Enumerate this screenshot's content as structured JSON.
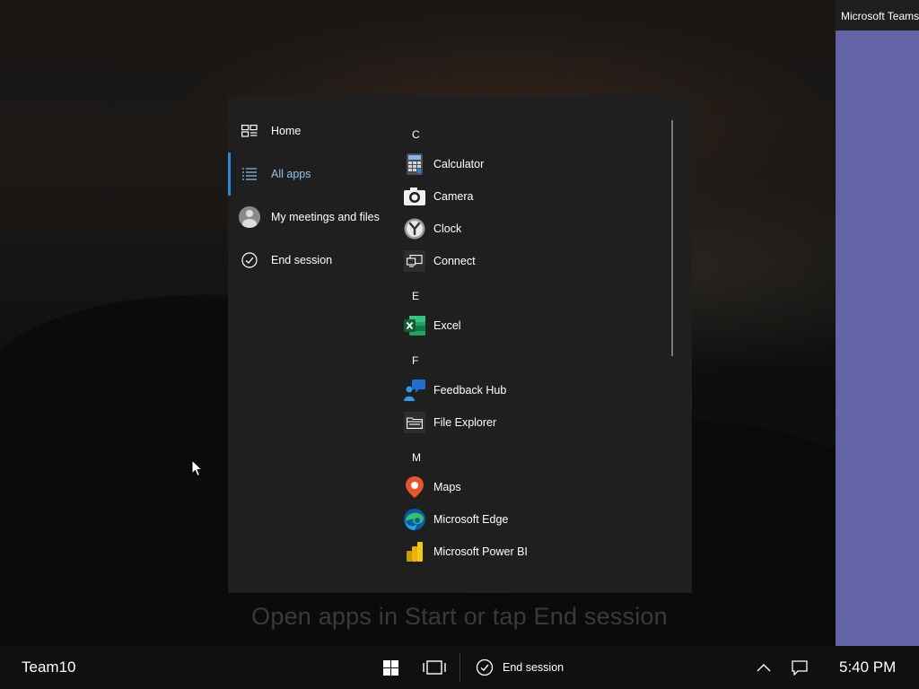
{
  "session": {
    "name": "Team10"
  },
  "hint": "Open apps in Start or tap End session",
  "teams_window": {
    "title": "Microsoft Teams"
  },
  "start_menu": {
    "nav": [
      {
        "label": "Home",
        "icon": "home-icon"
      },
      {
        "label": "All apps",
        "icon": "all-apps-icon",
        "active": true
      },
      {
        "label": "My meetings and files",
        "icon": "avatar-icon"
      },
      {
        "label": "End session",
        "icon": "check-circle-icon"
      }
    ],
    "groups": [
      {
        "letter": "C",
        "apps": [
          "Calculator",
          "Camera",
          "Clock",
          "Connect"
        ]
      },
      {
        "letter": "E",
        "apps": [
          "Excel"
        ]
      },
      {
        "letter": "F",
        "apps": [
          "Feedback Hub",
          "File Explorer"
        ]
      },
      {
        "letter": "M",
        "apps": [
          "Maps",
          "Microsoft Edge",
          "Microsoft Power BI"
        ]
      }
    ]
  },
  "taskbar": {
    "end_session_label": "End session",
    "time": "5:40 PM"
  },
  "colors": {
    "accent": "#2b88d8",
    "teams_purple": "#6264a7",
    "menu_bg": "#1f1f1f",
    "taskbar_bg": "#101010"
  }
}
